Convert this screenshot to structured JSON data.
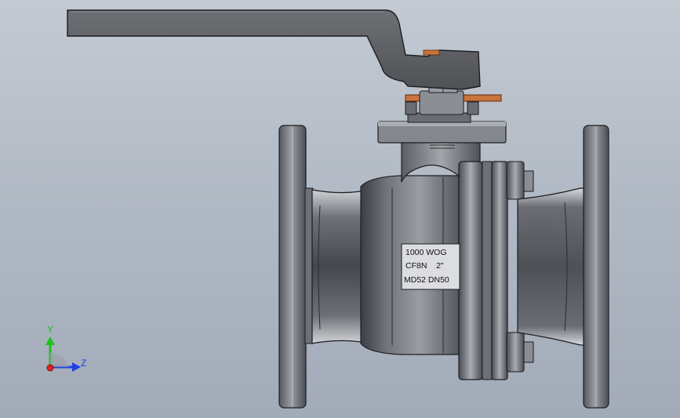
{
  "nameplate": {
    "line1": "1000 WOG",
    "line2": "CF8N    2\"",
    "line3": "MD52 DN50"
  },
  "triad": {
    "y_label": "Y",
    "z_label": "Z",
    "y_color": "#20c020",
    "z_color": "#2040e0",
    "x_color": "#e02020"
  },
  "colors": {
    "background_top": "#c3cad3",
    "background_bottom": "#a2abb8",
    "handle": "#55575c",
    "body_dark": "#3e4045",
    "body_mid": "#7a7d84",
    "body_light": "#c9cbd0",
    "washer": "#c8743a"
  }
}
